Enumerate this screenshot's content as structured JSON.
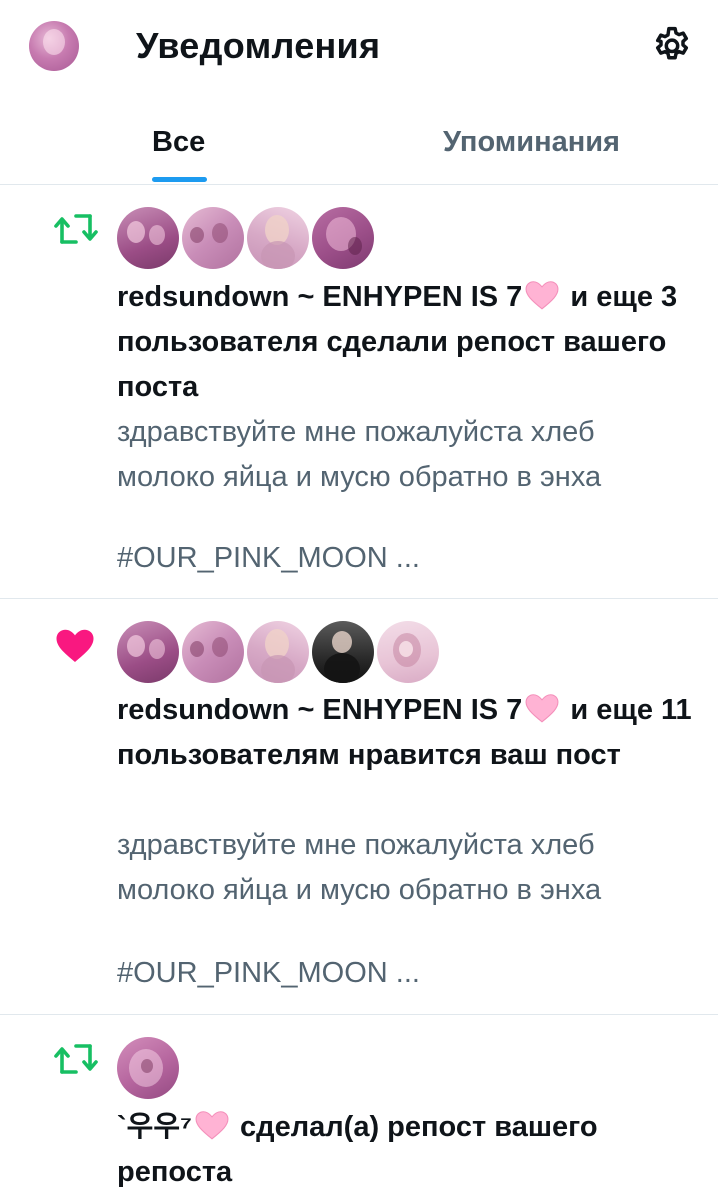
{
  "header": {
    "title": "Уведомления",
    "avatar_icon": "profile-avatar",
    "settings_icon": "gear-icon"
  },
  "tabs": [
    {
      "label": "Все",
      "active": true
    },
    {
      "label": "Упоминания",
      "active": false
    }
  ],
  "colors": {
    "retweet": "#17bf63",
    "like": "#f91880",
    "accent": "#1d9bf0",
    "secondary_text": "#536471"
  },
  "notifications": [
    {
      "type": "retweet",
      "icon": "retweet-icon",
      "user": "redsundown ~ ENHYPEN IS 7",
      "action": "и еще 3 пользователя сделали репост вашего поста",
      "preview": "здравствуйте мне пожалуйста хлеб молоко яйца и мусю обратно в энха",
      "tag": "#OUR_PINK_MOON ..."
    },
    {
      "type": "like",
      "icon": "heart-icon",
      "user": "redsundown ~ ENHYPEN IS 7",
      "action": "и еще 11 пользователям нравится ваш пост",
      "preview": "здравствуйте мне пожалуйста хлеб молоко яйца и мусю обратно в энха",
      "tag": "#OUR_PINK_MOON ..."
    },
    {
      "type": "retweet",
      "icon": "retweet-icon",
      "user": "`우우⁷",
      "action": "сделал(а) репост вашего репоста"
    }
  ]
}
